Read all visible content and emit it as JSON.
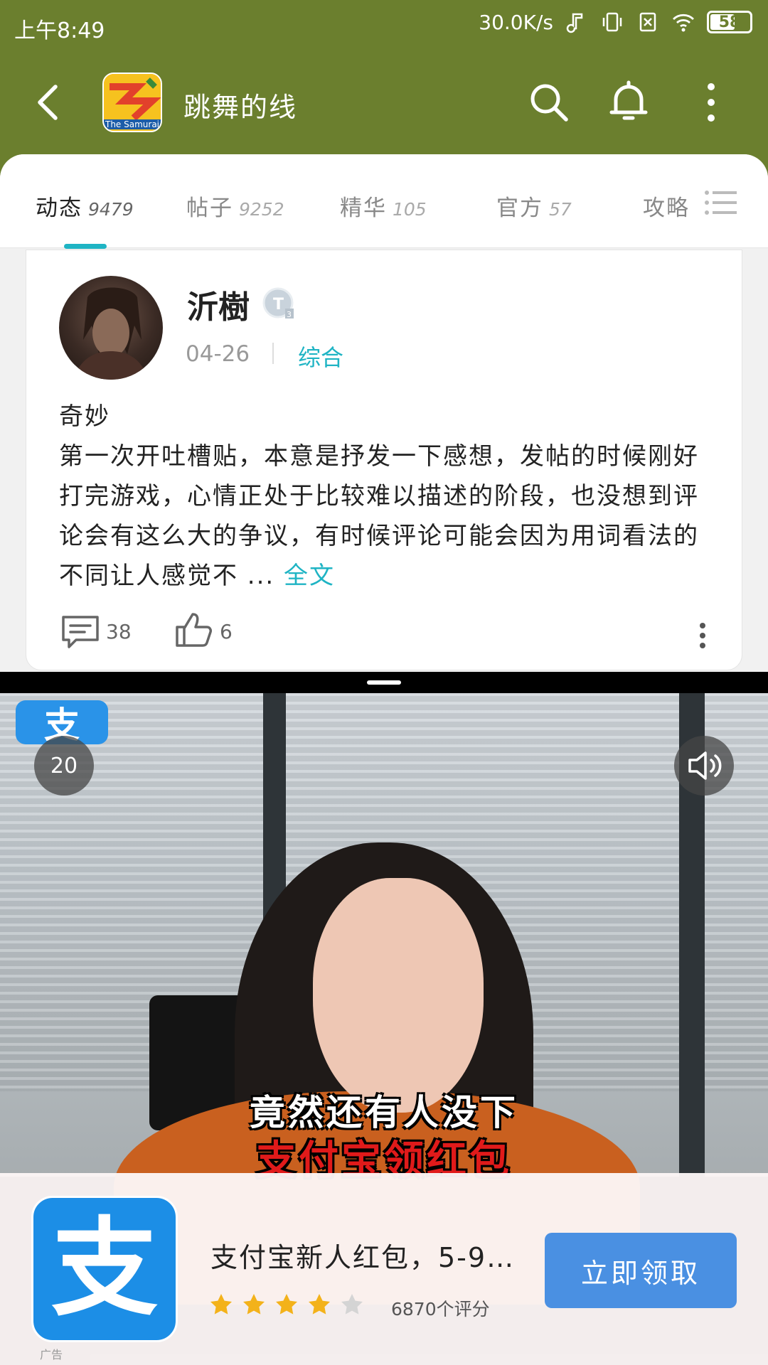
{
  "status_bar": {
    "time": "上午8:49",
    "net_speed": "30.0K/s",
    "battery": "58"
  },
  "nav": {
    "title": "跳舞的线",
    "game_icon_label": "The Samurai"
  },
  "tabs": [
    {
      "label": "动态",
      "count": "9479",
      "active": true
    },
    {
      "label": "帖子",
      "count": "9252",
      "active": false
    },
    {
      "label": "精华",
      "count": "105",
      "active": false
    },
    {
      "label": "官方",
      "count": "57",
      "active": false
    },
    {
      "label": "攻略",
      "count": "",
      "active": false
    }
  ],
  "post": {
    "username": "沂樹",
    "date": "04-26",
    "category": "综合",
    "title": "奇妙",
    "body": "第一次开吐槽贴，本意是抒发一下感想，发帖的时候刚好打完游戏，心情正处于比较难以描述的阶段，也没想到评论会有这么大的争议，有时候评论可能会因为用词看法的不同让人感觉不 ... ",
    "read_more": "全文",
    "comments": "38",
    "likes": "6"
  },
  "ad": {
    "corner_glyph": "支",
    "countdown": "20",
    "caption_line1": "竟然还有人没下",
    "caption_line2": "支付宝领红包",
    "app_glyph": "支",
    "ad_label": "广告",
    "title": "支付宝新人红包，5-9…",
    "rating": 4,
    "rating_text": "6870个评分",
    "cta": "立即领取"
  },
  "colors": {
    "header_bg": "#6b7f2e",
    "accent": "#1fb4c4",
    "cta_bg": "#4a90e2",
    "alipay_blue": "#1c8ee6",
    "star_gold": "#f3b21a"
  }
}
